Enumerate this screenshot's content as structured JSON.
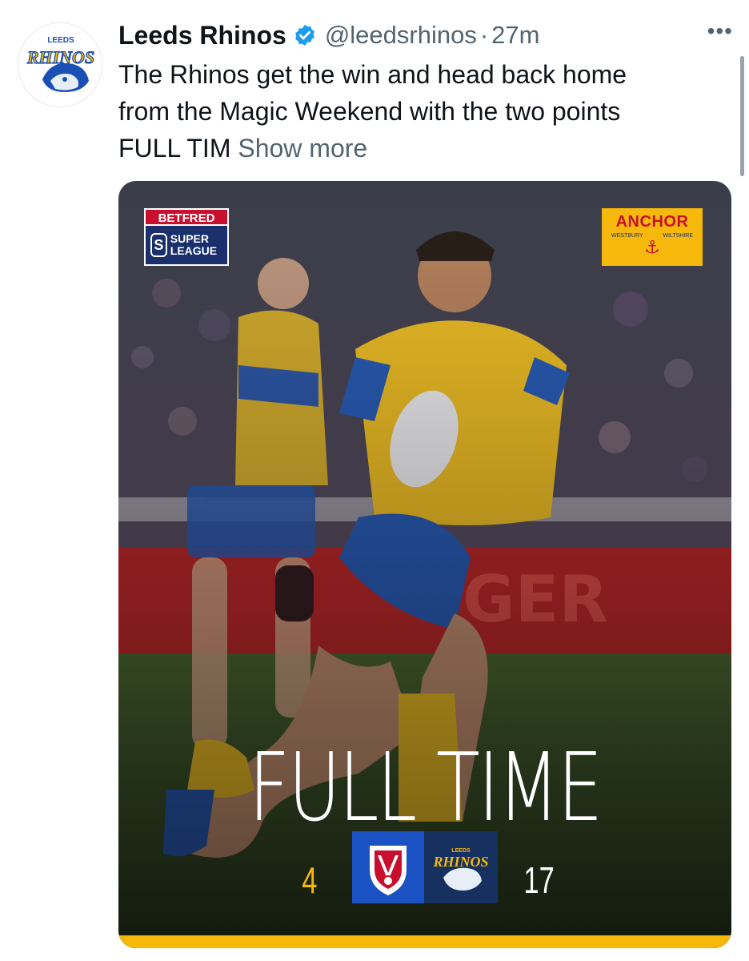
{
  "tweet": {
    "display_name": "Leeds Rhinos",
    "handle": "@leedsrhinos",
    "separator": "·",
    "time": "27m",
    "more_icon": "more-icon",
    "verified_icon": "verified-badge-icon",
    "text_lines": [
      "The Rhinos get the win and head back home",
      "from the Magic Weekend with the two points",
      "FULL TIM"
    ],
    "show_more": "Show more"
  },
  "avatar": {
    "logo_top": "LEEDS",
    "logo_main": "RHINOS"
  },
  "media": {
    "sponsor_left": {
      "top": "BETFRED",
      "bottom": "SUPER LEAGUE"
    },
    "sponsor_right": {
      "main": "ANCHOR",
      "sub_left": "WESTBURY",
      "sub_right": "WILTSHIRE"
    },
    "headline": "FULL TIME",
    "score_home": "4",
    "score_away": "17",
    "home_badge": "St Helens R.F.C.",
    "away_badge_top": "LEEDS",
    "away_badge_main": "RHINOS",
    "colors": {
      "gold": "#f5b80b",
      "blue": "#1a52c4",
      "navy": "#16305f",
      "red": "#c8102e"
    }
  }
}
